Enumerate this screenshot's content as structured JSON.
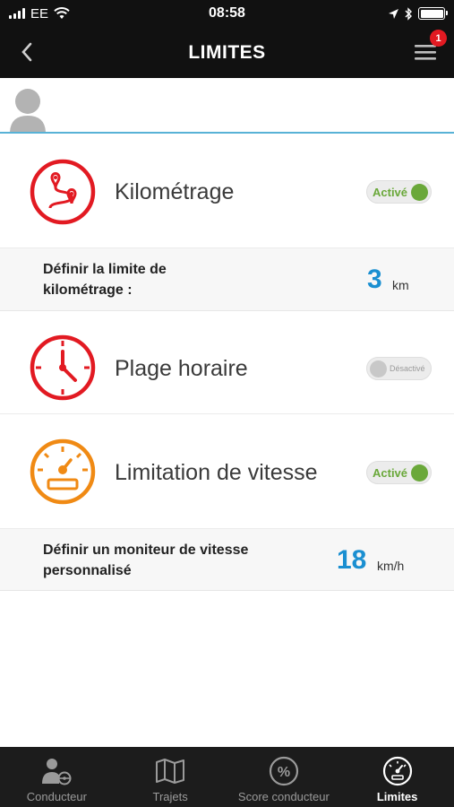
{
  "status_bar": {
    "carrier": "EE",
    "time": "08:58"
  },
  "nav": {
    "title": "LIMITES",
    "menu_badge": "1"
  },
  "features": [
    {
      "label": "Kilométrage",
      "icon": "route-pin-icon",
      "icon_color": "#e21a22",
      "toggle_label": "Activé",
      "enabled": true
    },
    {
      "label": "Plage horaire",
      "icon": "clock-icon",
      "icon_color": "#e21a22",
      "toggle_label": "Désactivé",
      "enabled": false
    },
    {
      "label": "Limitation de vitesse",
      "icon": "speedometer-icon",
      "icon_color": "#f08a14",
      "toggle_label": "Activé",
      "enabled": true
    }
  ],
  "settings": {
    "mileage": {
      "label_line1": "Définir la limite de",
      "label_line2": "kilométrage :",
      "value": "3",
      "unit": "km"
    },
    "speed": {
      "label_line1": "Définir un moniteur de vitesse",
      "label_line2": "personnalisé",
      "value": "18",
      "unit": "km/h"
    }
  },
  "tabs": [
    {
      "label": "Conducteur",
      "icon": "driver-icon",
      "active": false
    },
    {
      "label": "Trajets",
      "icon": "map-icon",
      "active": false
    },
    {
      "label": "Score conducteur",
      "icon": "percent-icon",
      "active": false
    },
    {
      "label": "Limites",
      "icon": "gauge-icon",
      "active": true
    }
  ],
  "colors": {
    "accent_blue": "#1a8fd1",
    "active_green": "#6aa83a",
    "alert_red": "#e21a22",
    "speed_orange": "#f08a14",
    "bar_dark": "#111111"
  }
}
